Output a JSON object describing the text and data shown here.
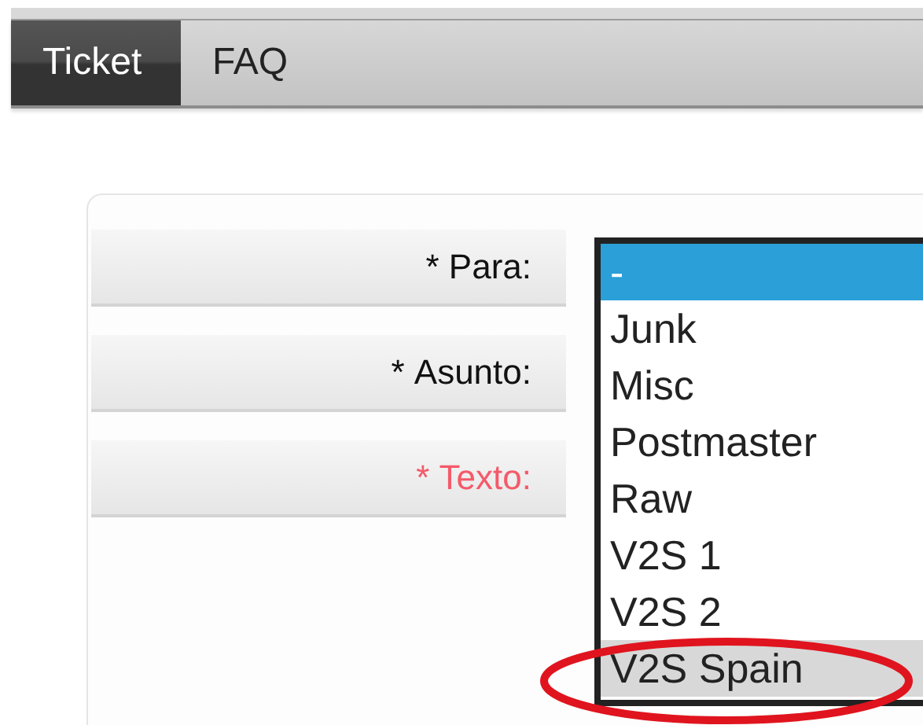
{
  "tabs": [
    {
      "label": "Ticket",
      "selected": true
    },
    {
      "label": "FAQ",
      "selected": false
    }
  ],
  "form": {
    "fields": [
      {
        "required_mark": "*",
        "label": "Para:",
        "error": false
      },
      {
        "required_mark": "*",
        "label": "Asunto:",
        "error": false
      },
      {
        "required_mark": "*",
        "label": "Texto:",
        "error": true
      }
    ],
    "dropdown": {
      "options": [
        {
          "label": "-",
          "selected": true,
          "highlighted": false
        },
        {
          "label": "Junk",
          "selected": false,
          "highlighted": false
        },
        {
          "label": "Misc",
          "selected": false,
          "highlighted": false
        },
        {
          "label": "Postmaster",
          "selected": false,
          "highlighted": false
        },
        {
          "label": "Raw",
          "selected": false,
          "highlighted": false
        },
        {
          "label": "V2S 1",
          "selected": false,
          "highlighted": false
        },
        {
          "label": "V2S 2",
          "selected": false,
          "highlighted": false
        },
        {
          "label": "V2S Spain",
          "selected": false,
          "highlighted": true
        }
      ]
    }
  },
  "annotation": {
    "kind": "ellipse",
    "color": "#e0141e"
  }
}
